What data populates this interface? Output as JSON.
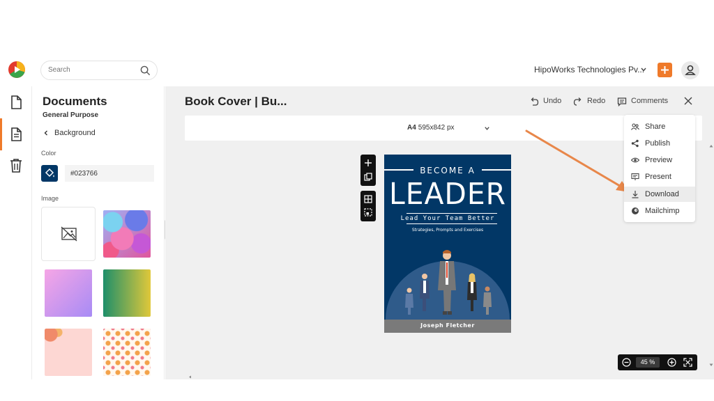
{
  "topbar": {
    "search_placeholder": "Search",
    "org_name": "HipoWorks Technologies Pv..."
  },
  "panel": {
    "title": "Documents",
    "subtitle": "General Purpose",
    "back_label": "Background",
    "color_label": "Color",
    "color_value": "#023766",
    "image_label": "Image"
  },
  "workspace": {
    "doc_title": "Book Cover | Bu...",
    "undo_label": "Undo",
    "redo_label": "Redo",
    "comments_label": "Comments",
    "page_size_name": "A4",
    "page_size_dims": "595x842 px"
  },
  "menu": {
    "items": [
      {
        "label": "Share",
        "icon": "share-users-icon"
      },
      {
        "label": "Publish",
        "icon": "publish-icon"
      },
      {
        "label": "Preview",
        "icon": "eye-icon"
      },
      {
        "label": "Present",
        "icon": "present-icon"
      },
      {
        "label": "Download",
        "icon": "download-icon",
        "highlighted": true
      },
      {
        "label": "Mailchimp",
        "icon": "mailchimp-icon"
      }
    ]
  },
  "book": {
    "kicker": "BECOME A",
    "title": "LEADER",
    "subtitle": "Lead Your Team Better",
    "subtitle2": "Strategies, Prompts and Exercises",
    "author": "Joseph Fletcher"
  },
  "zoom": {
    "value": "45",
    "unit": "%"
  },
  "colors": {
    "accent": "#ef7a2a",
    "book_background": "#023766",
    "annotation_arrow": "#e8874a"
  }
}
